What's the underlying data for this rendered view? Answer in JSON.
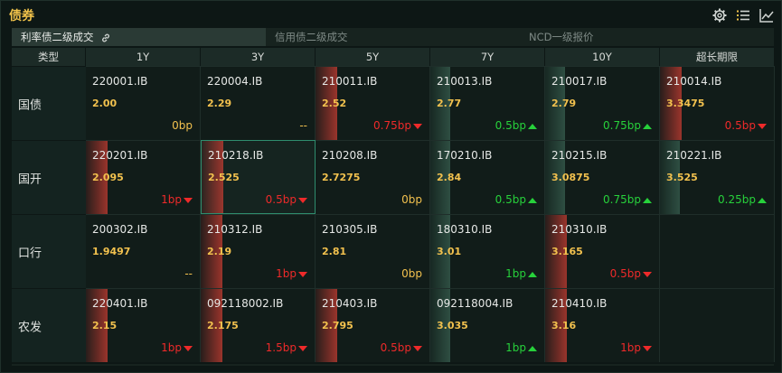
{
  "app": {
    "title": "债券"
  },
  "tabs": [
    {
      "label": "利率债二级成交",
      "active": true
    },
    {
      "label": "信用债二级成交",
      "active": false
    },
    {
      "label": "NCD一级报价",
      "active": false
    }
  ],
  "table": {
    "corner": "类型",
    "columns": [
      "1Y",
      "3Y",
      "5Y",
      "7Y",
      "10Y",
      "超长期限"
    ],
    "rows": [
      {
        "label": "国债",
        "cells": [
          {
            "code": "220001.IB",
            "yield": "2.00",
            "change": "0bp",
            "dir": "flat"
          },
          {
            "code": "220004.IB",
            "yield": "2.29",
            "change": "--",
            "dir": "flat"
          },
          {
            "code": "210011.IB",
            "yield": "2.52",
            "change": "0.75bp",
            "dir": "down"
          },
          {
            "code": "210013.IB",
            "yield": "2.77",
            "change": "0.5bp",
            "dir": "up"
          },
          {
            "code": "210017.IB",
            "yield": "2.79",
            "change": "0.75bp",
            "dir": "up"
          },
          {
            "code": "210014.IB",
            "yield": "3.3475",
            "change": "0.5bp",
            "dir": "down"
          }
        ]
      },
      {
        "label": "国开",
        "cells": [
          {
            "code": "220201.IB",
            "yield": "2.095",
            "change": "1bp",
            "dir": "down"
          },
          {
            "code": "210218.IB",
            "yield": "2.525",
            "change": "0.5bp",
            "dir": "down"
          },
          {
            "code": "210208.IB",
            "yield": "2.7275",
            "change": "0bp",
            "dir": "flat"
          },
          {
            "code": "170210.IB",
            "yield": "2.84",
            "change": "0.5bp",
            "dir": "up"
          },
          {
            "code": "210215.IB",
            "yield": "3.0875",
            "change": "0.75bp",
            "dir": "up"
          },
          {
            "code": "210221.IB",
            "yield": "3.525",
            "change": "0.25bp",
            "dir": "up"
          }
        ]
      },
      {
        "label": "口行",
        "cells": [
          {
            "code": "200302.IB",
            "yield": "1.9497",
            "change": "--",
            "dir": "flat"
          },
          {
            "code": "210312.IB",
            "yield": "2.19",
            "change": "1bp",
            "dir": "down"
          },
          {
            "code": "210305.IB",
            "yield": "2.81",
            "change": "0bp",
            "dir": "flat"
          },
          {
            "code": "180310.IB",
            "yield": "3.01",
            "change": "1bp",
            "dir": "up"
          },
          {
            "code": "210310.IB",
            "yield": "3.165",
            "change": "0.5bp",
            "dir": "down"
          },
          null
        ]
      },
      {
        "label": "农发",
        "cells": [
          {
            "code": "220401.IB",
            "yield": "2.15",
            "change": "1bp",
            "dir": "down"
          },
          {
            "code": "092118002.IB",
            "yield": "2.175",
            "change": "1.5bp",
            "dir": "down"
          },
          {
            "code": "210403.IB",
            "yield": "2.795",
            "change": "0.5bp",
            "dir": "down"
          },
          {
            "code": "092118004.IB",
            "yield": "3.035",
            "change": "1bp",
            "dir": "up"
          },
          {
            "code": "210410.IB",
            "yield": "3.16",
            "change": "1bp",
            "dir": "down"
          },
          null
        ]
      }
    ],
    "selected": {
      "row": 1,
      "col": 1
    }
  },
  "colors": {
    "title": "#f0c24a",
    "yield": "#f2c14e",
    "up": "#27d13b",
    "down": "#ee2a2a",
    "flat": "#f2c14e",
    "selected_border": "#2f8d6e"
  },
  "icons": [
    "gear-icon",
    "list-icon",
    "chart-icon",
    "link-icon"
  ]
}
